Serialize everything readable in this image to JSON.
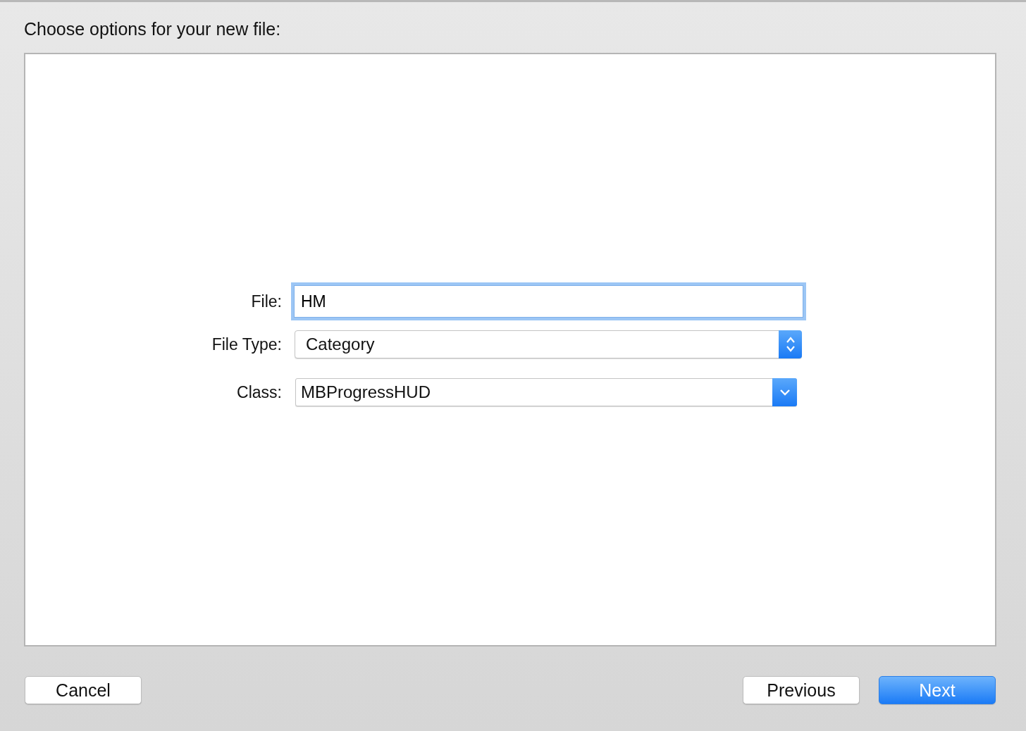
{
  "header": {
    "title": "Choose options for your new file:"
  },
  "fields": [
    {
      "kind": "text",
      "label": "File:",
      "value": "HM",
      "focused": true
    },
    {
      "kind": "popup",
      "label": "File Type:",
      "value": "Category"
    },
    {
      "kind": "combo",
      "label": "Class:",
      "value": "MBProgressHUD"
    }
  ],
  "left_buttons": [
    {
      "label": "Cancel",
      "default": false
    }
  ],
  "right_buttons": [
    {
      "label": "Previous",
      "default": false
    },
    {
      "label": "Next",
      "default": true
    }
  ]
}
